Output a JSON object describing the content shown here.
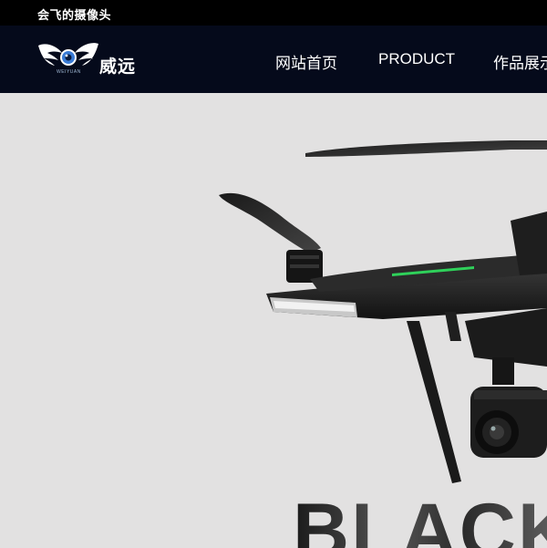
{
  "topbar": {
    "tagline": "会飞的摄像头"
  },
  "logo": {
    "brand": "威远",
    "sub": "WEIYUAN"
  },
  "nav": {
    "items": [
      {
        "label": "网站首页"
      },
      {
        "label": "PRODUCT"
      },
      {
        "label": "作品展示"
      }
    ]
  },
  "hero": {
    "headline": "BLACK"
  },
  "colors": {
    "topbar_bg": "#000000",
    "navbar_bg": "#050a1b",
    "hero_bg": "#e2e1e1",
    "accent_green": "#2fd15a",
    "logo_eye": "#3a7bd5"
  }
}
